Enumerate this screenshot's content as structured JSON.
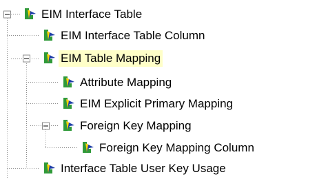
{
  "tree": {
    "nodes": [
      {
        "id": "n1",
        "label": "EIM Interface Table",
        "level": 0,
        "expanded": true,
        "selected": false
      },
      {
        "id": "n2",
        "label": "EIM Interface Table Column",
        "level": 1,
        "expanded": null,
        "selected": false
      },
      {
        "id": "n3",
        "label": "EIM Table Mapping",
        "level": 1,
        "expanded": true,
        "selected": true
      },
      {
        "id": "n4",
        "label": "Attribute Mapping",
        "level": 2,
        "expanded": null,
        "selected": false
      },
      {
        "id": "n5",
        "label": "EIM Explicit Primary Mapping",
        "level": 2,
        "expanded": null,
        "selected": false
      },
      {
        "id": "n6",
        "label": "Foreign Key Mapping",
        "level": 2,
        "expanded": true,
        "selected": false
      },
      {
        "id": "n7",
        "label": "Foreign Key Mapping Column",
        "level": 3,
        "expanded": null,
        "selected": false
      },
      {
        "id": "n8",
        "label": "Interface Table User Key Usage",
        "level": 1,
        "expanded": null,
        "selected": false
      }
    ]
  },
  "colors": {
    "selected_bg": "#ffffc8",
    "connector": "#8c8c8c",
    "icon_green": "#2f9a39",
    "icon_blue": "#1f3fa8"
  },
  "icons": {
    "node": "schema-object-icon",
    "expander": "collapse-minus-icon"
  }
}
